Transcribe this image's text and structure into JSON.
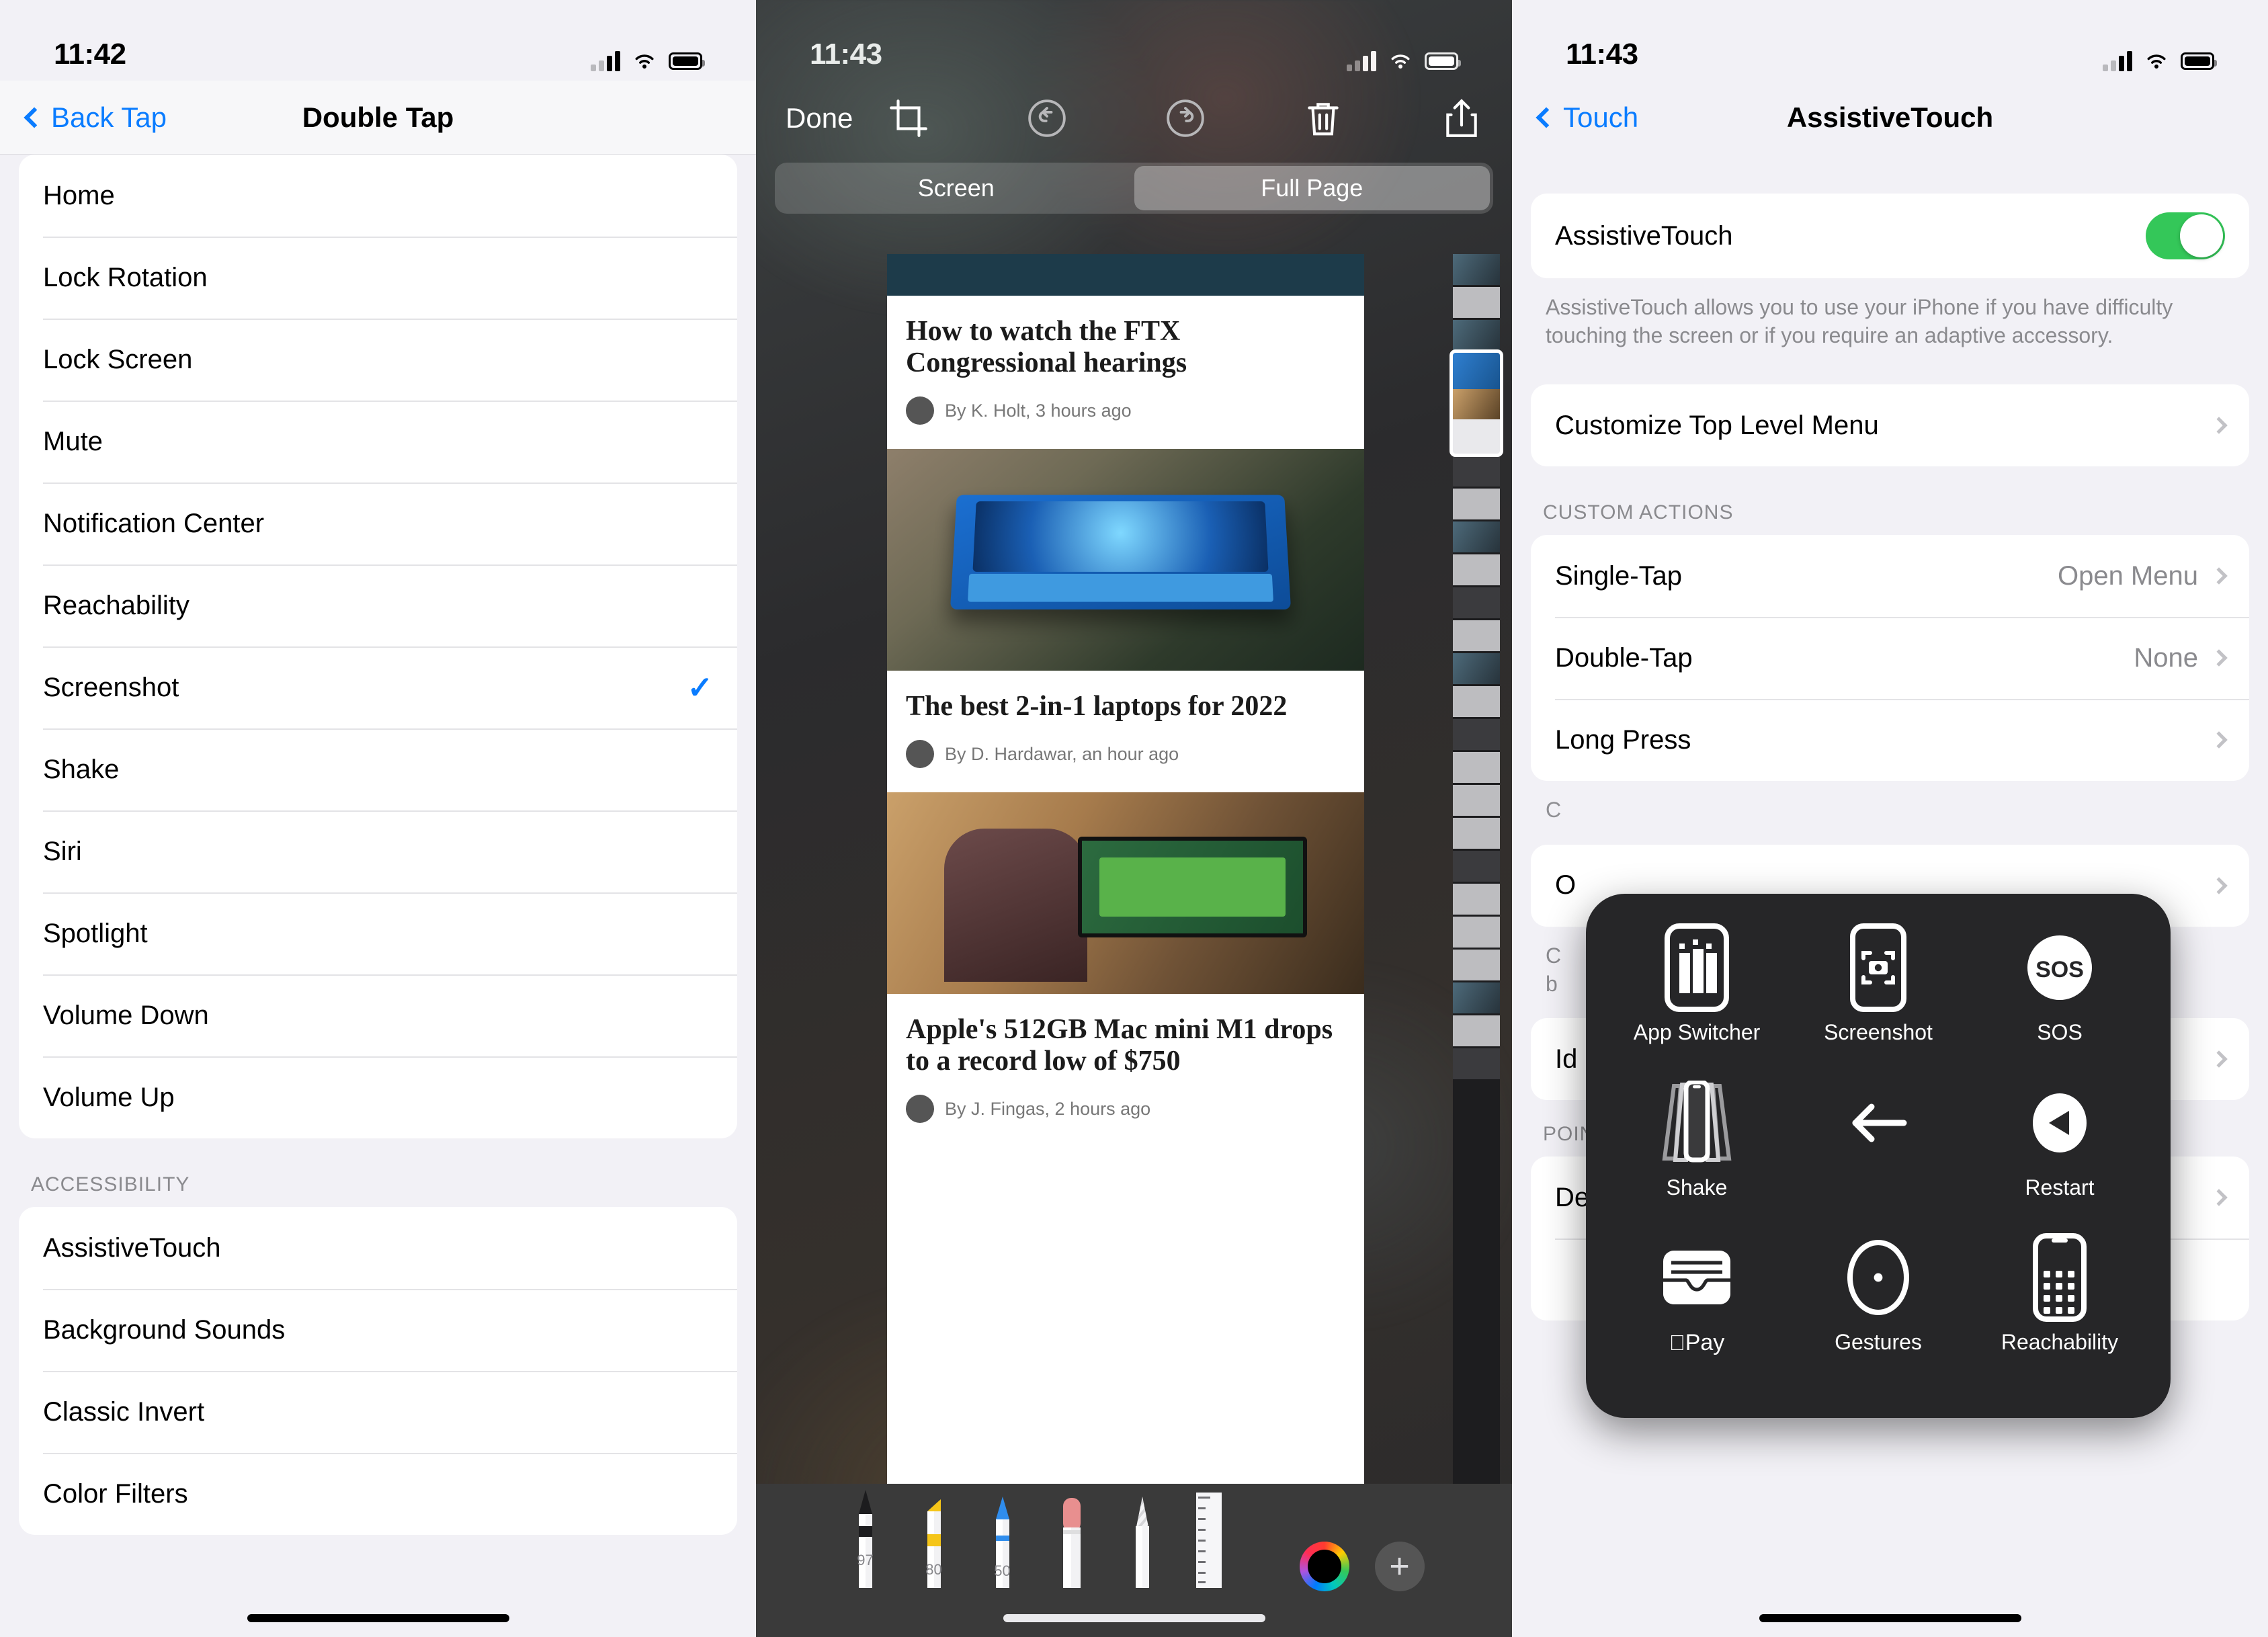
{
  "left": {
    "status": {
      "time": "11:42"
    },
    "nav": {
      "back": "Back Tap",
      "title": "Double Tap"
    },
    "actions": [
      {
        "label": "Home",
        "checked": false
      },
      {
        "label": "Lock Rotation",
        "checked": false
      },
      {
        "label": "Lock Screen",
        "checked": false
      },
      {
        "label": "Mute",
        "checked": false
      },
      {
        "label": "Notification Center",
        "checked": false
      },
      {
        "label": "Reachability",
        "checked": false
      },
      {
        "label": "Screenshot",
        "checked": true
      },
      {
        "label": "Shake",
        "checked": false
      },
      {
        "label": "Siri",
        "checked": false
      },
      {
        "label": "Spotlight",
        "checked": false
      },
      {
        "label": "Volume Down",
        "checked": false
      },
      {
        "label": "Volume Up",
        "checked": false
      }
    ],
    "accessibility_header": "ACCESSIBILITY",
    "accessibility": [
      {
        "label": "AssistiveTouch"
      },
      {
        "label": "Background Sounds"
      },
      {
        "label": "Classic Invert"
      },
      {
        "label": "Color Filters"
      }
    ]
  },
  "middle": {
    "status": {
      "time": "11:43"
    },
    "toolbar": {
      "done_label": "Done",
      "icons": [
        "crop-icon",
        "undo-icon",
        "redo-icon",
        "trash-icon",
        "share-icon"
      ]
    },
    "segments": [
      {
        "label": "Screen",
        "selected": false
      },
      {
        "label": "Full Page",
        "selected": true
      }
    ],
    "articles": [
      {
        "title": "How to watch the FTX Congressional hearings",
        "byline": "By K. Holt, 3 hours ago"
      },
      {
        "title": "The best 2-in-1 laptops for 2022",
        "byline": "By D. Hardawar, an hour ago"
      },
      {
        "title": "Apple's 512GB Mac mini M1 drops to a record low of $750",
        "byline": "By J. Fingas, 2 hours ago"
      }
    ],
    "markup_tools": [
      {
        "name": "pen-tool",
        "value": "97"
      },
      {
        "name": "highlighter-tool",
        "value": "80"
      },
      {
        "name": "pencil-tool",
        "value": "50"
      },
      {
        "name": "eraser-tool",
        "value": ""
      },
      {
        "name": "lasso-tool",
        "value": ""
      },
      {
        "name": "ruler-tool",
        "value": ""
      }
    ],
    "color_swatch": "#000000",
    "add_label": "+"
  },
  "right": {
    "status": {
      "time": "11:43"
    },
    "nav": {
      "back": "Touch",
      "title": "AssistiveTouch"
    },
    "toggle_row": {
      "label": "AssistiveTouch",
      "on": true,
      "accent": "#34c759"
    },
    "description": "AssistiveTouch allows you to use your iPhone if you have difficulty touching the screen or if you require an adaptive accessory.",
    "customize_row": {
      "label": "Customize Top Level Menu"
    },
    "custom_actions_header": "CUSTOM ACTIONS",
    "custom_actions": [
      {
        "label": "Single-Tap",
        "value": "Open Menu"
      },
      {
        "label": "Double-Tap",
        "value": "None"
      },
      {
        "label": "Long Press",
        "value": ""
      }
    ],
    "obscured_rows": [
      {
        "label": "C"
      },
      {
        "label": "O"
      },
      {
        "label": "Id"
      }
    ],
    "pointer_devices_header": "POINTER DEVICES",
    "devices_row": {
      "label": "Devices"
    },
    "assistive_menu": [
      {
        "label": "App Switcher",
        "icon": "app-switcher-icon"
      },
      {
        "label": "Screenshot",
        "icon": "screenshot-icon"
      },
      {
        "label": "SOS",
        "icon": "sos-icon"
      },
      {
        "label": "Shake",
        "icon": "shake-icon"
      },
      {
        "label": "",
        "icon": "back-arrow-icon"
      },
      {
        "label": "Restart",
        "icon": "restart-icon"
      },
      {
        "label": "Pay",
        "icon": "apple-pay-icon"
      },
      {
        "label": "Gestures",
        "icon": "gestures-icon"
      },
      {
        "label": "Reachability",
        "icon": "reachability-icon"
      }
    ]
  }
}
